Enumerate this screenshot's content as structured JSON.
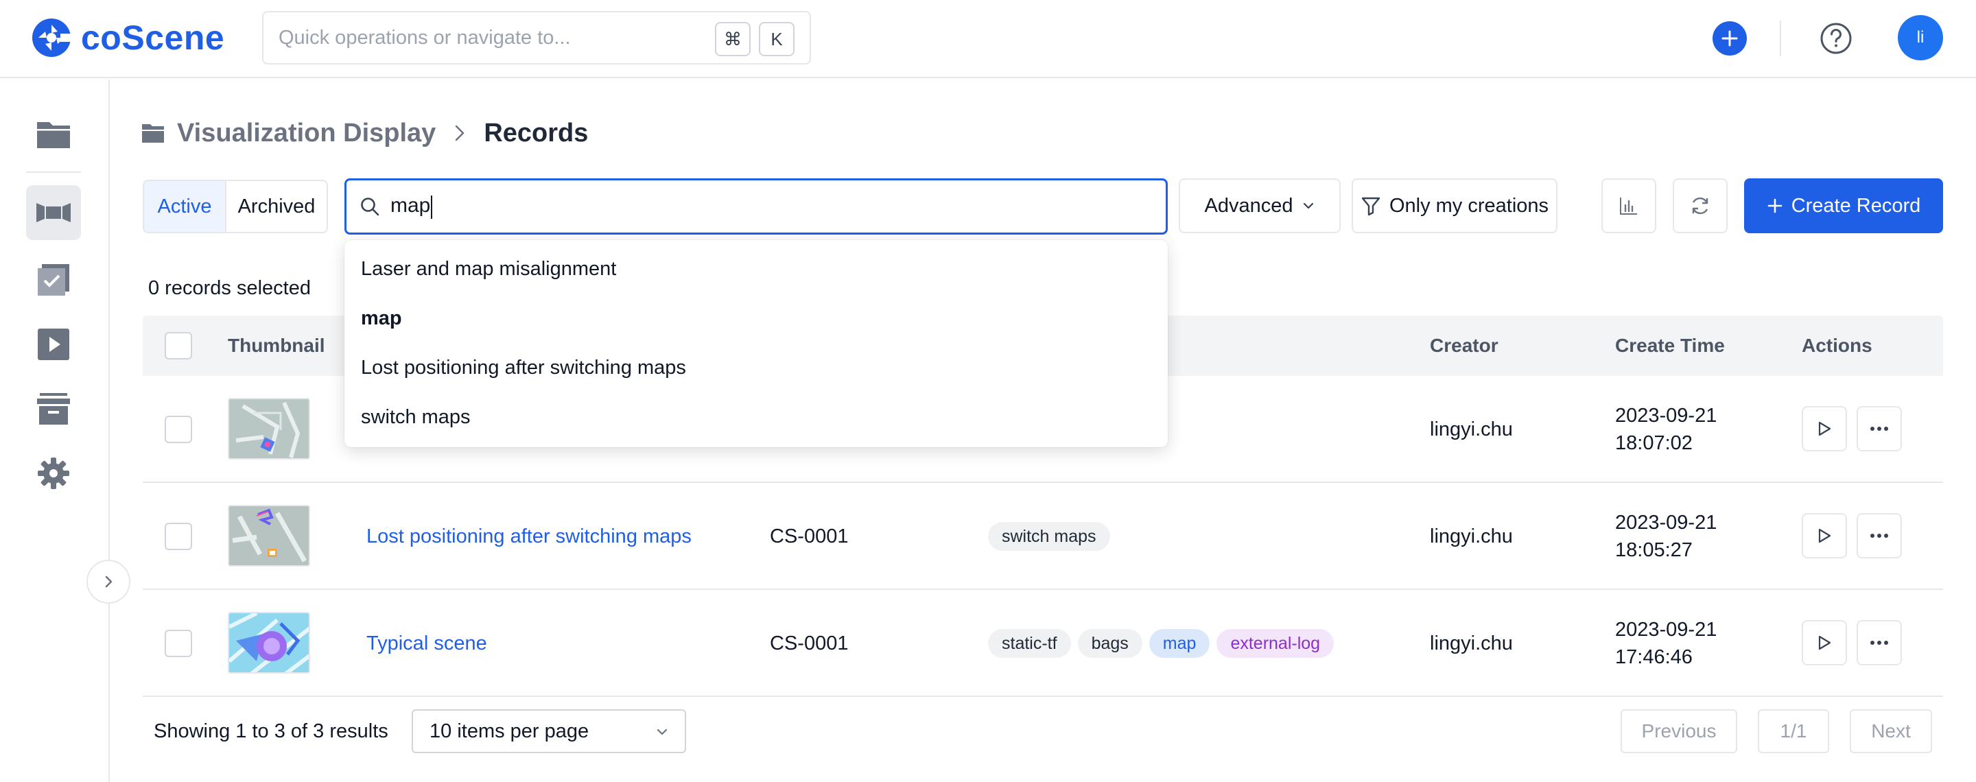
{
  "brand": {
    "name": "coScene",
    "color": "#1f5fe6"
  },
  "quick_search": {
    "placeholder": "Quick operations or navigate to...",
    "shortcut_mod": "⌘",
    "shortcut_key": "K"
  },
  "user": {
    "initials": "li"
  },
  "sidebar": {
    "items": [
      {
        "icon": "folder-icon",
        "active": false
      },
      {
        "icon": "record-icon",
        "active": true
      },
      {
        "icon": "task-icon",
        "active": false
      },
      {
        "icon": "play-icon",
        "active": false
      },
      {
        "icon": "archive-icon",
        "active": false
      },
      {
        "icon": "gear-icon",
        "active": false
      }
    ]
  },
  "breadcrumb": {
    "root": "Visualization Display",
    "current": "Records"
  },
  "toolbar": {
    "tab_active": "Active",
    "tab_archived": "Archived",
    "search_value": "map",
    "advanced_label": "Advanced",
    "only_mine_label": "Only my creations",
    "create_label": "Create Record"
  },
  "suggestions": [
    {
      "text": "Laser and map misalignment",
      "bold": false
    },
    {
      "text": "map",
      "bold": true
    },
    {
      "text": "Lost positioning after switching maps",
      "bold": false
    },
    {
      "text": "switch maps",
      "bold": false
    }
  ],
  "selection": {
    "count_text": "0 records selected"
  },
  "table": {
    "headers": {
      "thumbnail": "Thumbnail",
      "creator": "Creator",
      "create_time": "Create Time",
      "actions": "Actions"
    },
    "rows": [
      {
        "name": "",
        "project": "",
        "tags": [],
        "creator": "lingyi.chu",
        "date": "2023-09-21",
        "time": "18:07:02"
      },
      {
        "name": "Lost positioning after switching maps",
        "project": "CS-0001",
        "tags": [
          {
            "text": "switch maps",
            "style": "gray"
          }
        ],
        "creator": "lingyi.chu",
        "date": "2023-09-21",
        "time": "18:05:27"
      },
      {
        "name": "Typical scene",
        "project": "CS-0001",
        "tags": [
          {
            "text": "static-tf",
            "style": "gray"
          },
          {
            "text": "bags",
            "style": "gray"
          },
          {
            "text": "map",
            "style": "blue"
          },
          {
            "text": "external-log",
            "style": "purple"
          }
        ],
        "creator": "lingyi.chu",
        "date": "2023-09-21",
        "time": "17:46:46"
      }
    ]
  },
  "pagination": {
    "showing_text": "Showing 1 to 3 of 3 results",
    "per_page": "10 items per page",
    "prev_label": "Previous",
    "page_indicator": "1/1",
    "next_label": "Next"
  }
}
